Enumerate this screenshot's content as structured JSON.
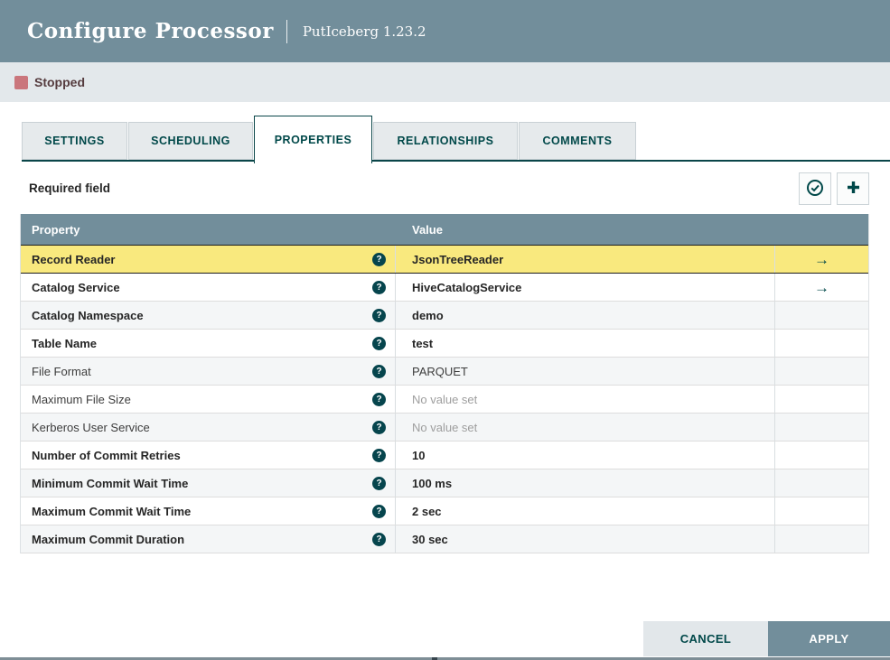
{
  "header": {
    "title": "Configure Processor",
    "subtitle": "PutIceberg 1.23.2"
  },
  "status": {
    "label": "Stopped"
  },
  "tabs": [
    {
      "label": "SETTINGS"
    },
    {
      "label": "SCHEDULING"
    },
    {
      "label": "PROPERTIES",
      "active": true
    },
    {
      "label": "RELATIONSHIPS"
    },
    {
      "label": "COMMENTS"
    }
  ],
  "properties_panel": {
    "required_field_label": "Required field",
    "verify_button": "verify-properties",
    "add_button": "add-property"
  },
  "icons": {
    "help_glyph": "?",
    "goto_arrow": "→"
  },
  "table": {
    "columns": [
      "Property",
      "Value"
    ],
    "rows": [
      {
        "property": "Record Reader",
        "value": "JsonTreeReader",
        "required": true,
        "selected": true,
        "has_link": true
      },
      {
        "property": "Catalog Service",
        "value": "HiveCatalogService",
        "required": true,
        "selected": false,
        "has_link": true
      },
      {
        "property": "Catalog Namespace",
        "value": "demo",
        "required": true,
        "selected": false,
        "has_link": false
      },
      {
        "property": "Table Name",
        "value": "test",
        "required": true,
        "selected": false,
        "has_link": false
      },
      {
        "property": "File Format",
        "value": "PARQUET",
        "required": false,
        "selected": false,
        "has_link": false
      },
      {
        "property": "Maximum File Size",
        "value": "No value set",
        "required": false,
        "selected": false,
        "has_link": false,
        "empty": true
      },
      {
        "property": "Kerberos User Service",
        "value": "No value set",
        "required": false,
        "selected": false,
        "has_link": false,
        "empty": true
      },
      {
        "property": "Number of Commit Retries",
        "value": "10",
        "required": true,
        "selected": false,
        "has_link": false
      },
      {
        "property": "Minimum Commit Wait Time",
        "value": "100 ms",
        "required": true,
        "selected": false,
        "has_link": false
      },
      {
        "property": "Maximum Commit Wait Time",
        "value": "2 sec",
        "required": true,
        "selected": false,
        "has_link": false
      },
      {
        "property": "Maximum Commit Duration",
        "value": "30 sec",
        "required": true,
        "selected": false,
        "has_link": false
      }
    ]
  },
  "footer": {
    "cancel_label": "CANCEL",
    "apply_label": "APPLY"
  },
  "colors": {
    "header_bg": "#728E9B",
    "status_bar_bg": "#E3E8EB",
    "stopped_red": "#CA767C",
    "stopped_text": "#553B3E",
    "accent_teal": "#004849",
    "selected_row_yellow": "#F9E97E",
    "alt_row_bg": "#F4F6F7",
    "table_header_bg": "#728E9B",
    "apply_bg": "#728E9B",
    "cancel_bg": "#E2E7EA"
  }
}
